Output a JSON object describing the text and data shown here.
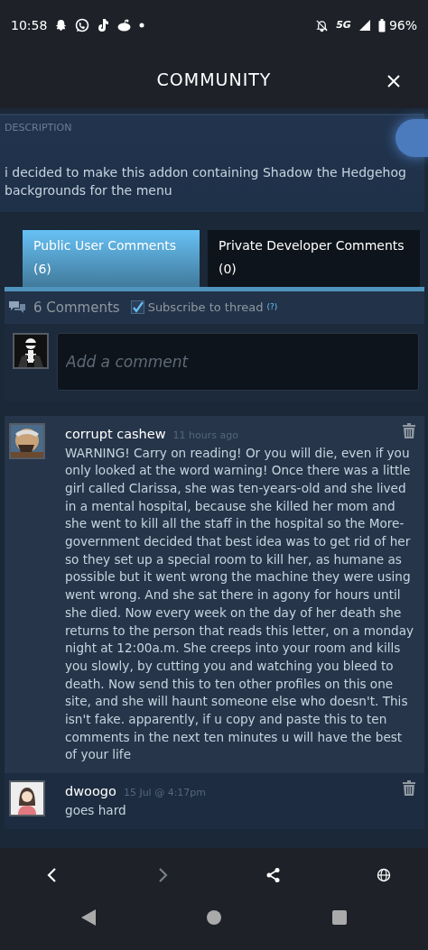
{
  "status_bar": {
    "time": "10:58",
    "network": "5G",
    "battery": "96%"
  },
  "header": {
    "title": "COMMUNITY"
  },
  "description": {
    "label": "DESCRIPTION",
    "text": "i decided to make this addon containing Shadow the Hedgehog backgrounds for the menu"
  },
  "tabs": [
    {
      "label": "Public User Comments",
      "count": "(6)",
      "selected": true
    },
    {
      "label": "Private Developer Comments",
      "count": "(0)",
      "selected": false
    }
  ],
  "comments_bar": {
    "count": "6 Comments",
    "subscribe_label": "Subscribe to thread",
    "help": "(?)",
    "subscribed": true
  },
  "comment_input": {
    "placeholder": "Add a comment"
  },
  "comments": [
    {
      "author": "corrupt cashew",
      "time": "11 hours ago",
      "text": "WARNING! Carry on reading! Or you will die, even if you only looked at the word warning! Once there was a little girl called Clarissa, she was ten-years-old and she lived in a mental hospital, because she killed her mom and she went to kill all the staff in the hospital so the More- government decided that best idea was to get rid of her so they set up a special room to kill her, as humane as possible but it went wrong the machine they were using went wrong. And she sat there in agony for hours until she died. Now every week on the day of her death she returns to the person that reads this letter, on a monday night at 12:00a.m. She creeps into your room and kills you slowly, by cutting you and watching you bleed to death. Now send this to ten other profiles on this one site, and she will haunt someone else who doesn't. This isn't fake. apparently, if u copy and paste this to ten comments in the next ten minutes u will have the best of your life",
      "highlighted": true
    },
    {
      "author": "dwoogo",
      "time": "15 Jul @ 4:17pm",
      "text": "goes hard",
      "highlighted": false
    }
  ],
  "browser_bar": [
    {
      "kind": "back",
      "disabled": false
    },
    {
      "kind": "forward",
      "disabled": true
    },
    {
      "kind": "share",
      "disabled": false
    },
    {
      "kind": "globe",
      "disabled": false
    }
  ]
}
